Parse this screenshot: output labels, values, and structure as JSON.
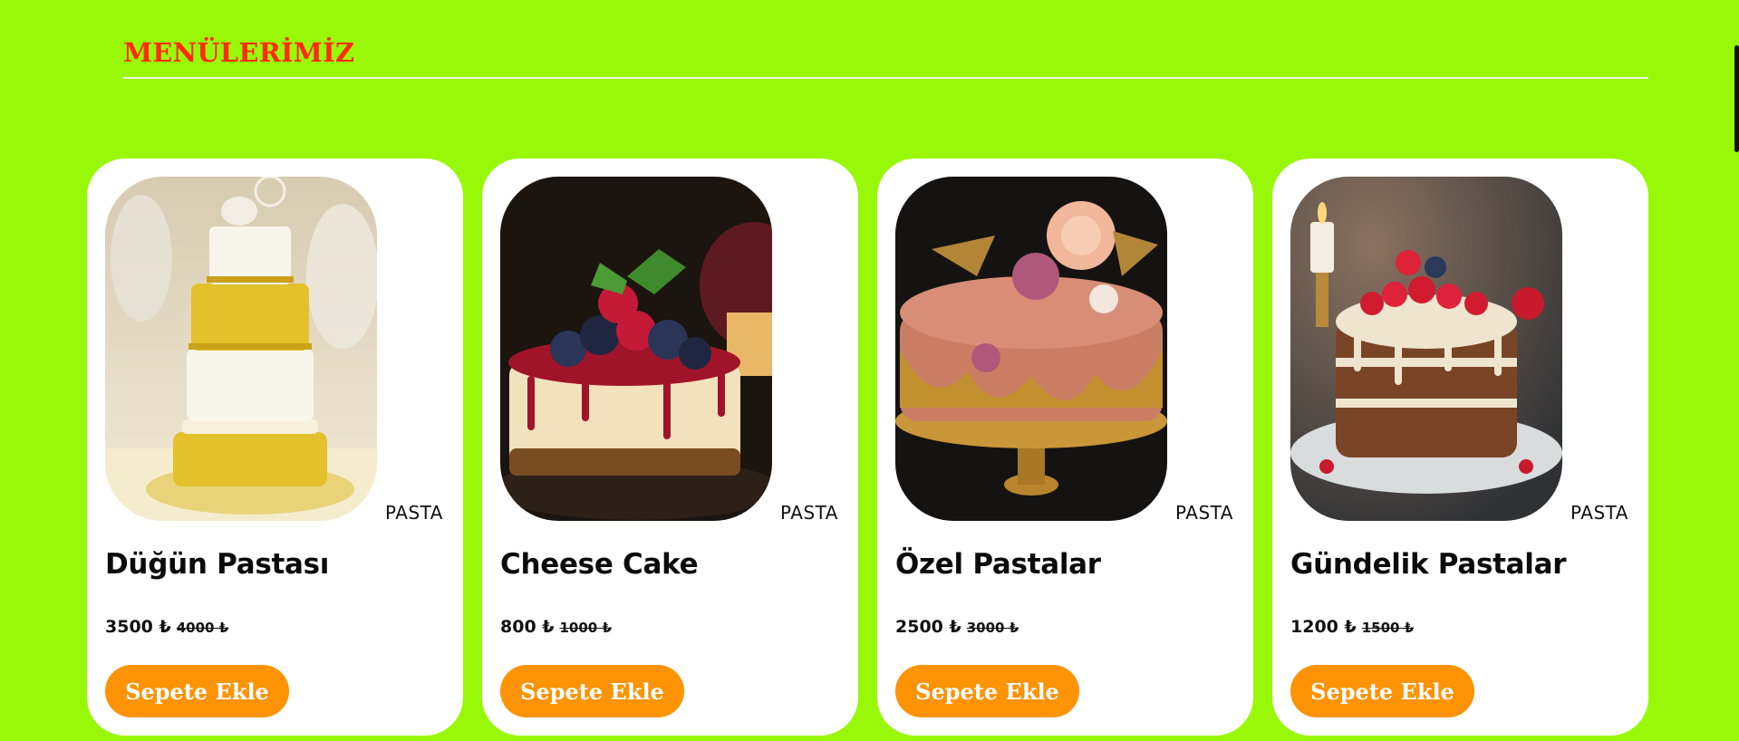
{
  "section": {
    "title": "MENÜLERİMİZ"
  },
  "colors": {
    "background": "#99f808",
    "title": "#ff2a10",
    "button": "#fd9305",
    "card": "#ffffff"
  },
  "products": [
    {
      "image": "wedding-cake-image",
      "category": "PASTA",
      "name": "Düğün Pastası",
      "price": "3500 ₺",
      "old_price": "4000 ₺",
      "button": "Sepete Ekle"
    },
    {
      "image": "cheesecake-image",
      "category": "PASTA",
      "name": "Cheese Cake",
      "price": "800 ₺",
      "old_price": "1000 ₺",
      "button": "Sepete Ekle"
    },
    {
      "image": "special-cake-image",
      "category": "PASTA",
      "name": "Özel Pastalar",
      "price": "2500 ₺",
      "old_price": "3000 ₺",
      "button": "Sepete Ekle"
    },
    {
      "image": "daily-cake-image",
      "category": "PASTA",
      "name": "Gündelik Pastalar",
      "price": "1200 ₺",
      "old_price": "1500 ₺",
      "button": "Sepete Ekle"
    }
  ]
}
